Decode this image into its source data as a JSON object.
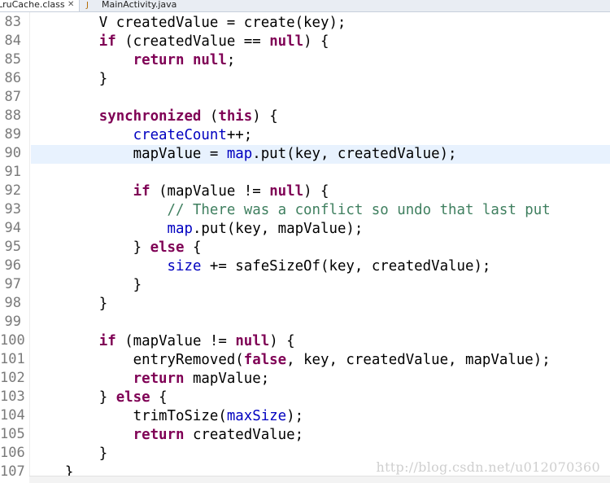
{
  "tabs": [
    {
      "label": "LruCache.class",
      "close_glyph": "✕",
      "active": true,
      "icon": "class-file-icon"
    },
    {
      "label": "MainActivity.java",
      "active": false,
      "icon": "java-file-icon",
      "icon_glyph": "J"
    }
  ],
  "code": {
    "line_numbers": [
      "83",
      "84",
      "85",
      "86",
      "87",
      "88",
      "89",
      "90",
      "91",
      "92",
      "93",
      "94",
      "95",
      "96",
      "97",
      "98",
      "99",
      "100",
      "101",
      "102",
      "103",
      "104",
      "105",
      "106",
      "107"
    ],
    "highlighted_line": "90",
    "lines": [
      [
        {
          "t": "        V createdValue = create(key);"
        }
      ],
      [
        {
          "t": "        "
        },
        {
          "t": "if",
          "k": "kw"
        },
        {
          "t": " (createdValue == "
        },
        {
          "t": "null",
          "k": "kw"
        },
        {
          "t": ") {"
        }
      ],
      [
        {
          "t": "            "
        },
        {
          "t": "return",
          "k": "kw"
        },
        {
          "t": " "
        },
        {
          "t": "null",
          "k": "kw"
        },
        {
          "t": ";"
        }
      ],
      [
        {
          "t": "        }"
        }
      ],
      [
        {
          "t": ""
        }
      ],
      [
        {
          "t": "        "
        },
        {
          "t": "synchronized",
          "k": "kw"
        },
        {
          "t": " ("
        },
        {
          "t": "this",
          "k": "kw"
        },
        {
          "t": ") {"
        }
      ],
      [
        {
          "t": "            "
        },
        {
          "t": "createCount",
          "k": "fld"
        },
        {
          "t": "++;"
        }
      ],
      [
        {
          "t": "            mapValue = "
        },
        {
          "t": "map",
          "k": "fld"
        },
        {
          "t": ".put(key, createdValue);"
        }
      ],
      [
        {
          "t": ""
        }
      ],
      [
        {
          "t": "            "
        },
        {
          "t": "if",
          "k": "kw"
        },
        {
          "t": " (mapValue != "
        },
        {
          "t": "null",
          "k": "kw"
        },
        {
          "t": ") {"
        }
      ],
      [
        {
          "t": "                "
        },
        {
          "t": "// There was a conflict so undo that last put",
          "k": "cmt"
        }
      ],
      [
        {
          "t": "                "
        },
        {
          "t": "map",
          "k": "fld"
        },
        {
          "t": ".put(key, mapValue);"
        }
      ],
      [
        {
          "t": "            } "
        },
        {
          "t": "else",
          "k": "kw"
        },
        {
          "t": " {"
        }
      ],
      [
        {
          "t": "                "
        },
        {
          "t": "size",
          "k": "fld"
        },
        {
          "t": " += safeSizeOf(key, createdValue);"
        }
      ],
      [
        {
          "t": "            }"
        }
      ],
      [
        {
          "t": "        }"
        }
      ],
      [
        {
          "t": ""
        }
      ],
      [
        {
          "t": "        "
        },
        {
          "t": "if",
          "k": "kw"
        },
        {
          "t": " (mapValue != "
        },
        {
          "t": "null",
          "k": "kw"
        },
        {
          "t": ") {"
        }
      ],
      [
        {
          "t": "            entryRemoved("
        },
        {
          "t": "false",
          "k": "kw"
        },
        {
          "t": ", key, createdValue, mapValue);"
        }
      ],
      [
        {
          "t": "            "
        },
        {
          "t": "return",
          "k": "kw"
        },
        {
          "t": " mapValue;"
        }
      ],
      [
        {
          "t": "        } "
        },
        {
          "t": "else",
          "k": "kw"
        },
        {
          "t": " {"
        }
      ],
      [
        {
          "t": "            trimToSize("
        },
        {
          "t": "maxSize",
          "k": "fld"
        },
        {
          "t": ");"
        }
      ],
      [
        {
          "t": "            "
        },
        {
          "t": "return",
          "k": "kw"
        },
        {
          "t": " createdValue;"
        }
      ],
      [
        {
          "t": "        }"
        }
      ],
      [
        {
          "t": "    }"
        }
      ]
    ]
  },
  "watermark": "http://blog.csdn.net/u012070360",
  "colors": {
    "keyword": "#7f0055",
    "field": "#0000c0",
    "comment": "#3f7f5f",
    "current_line": "#e8f2fe",
    "line_number": "#7a7a7a"
  }
}
